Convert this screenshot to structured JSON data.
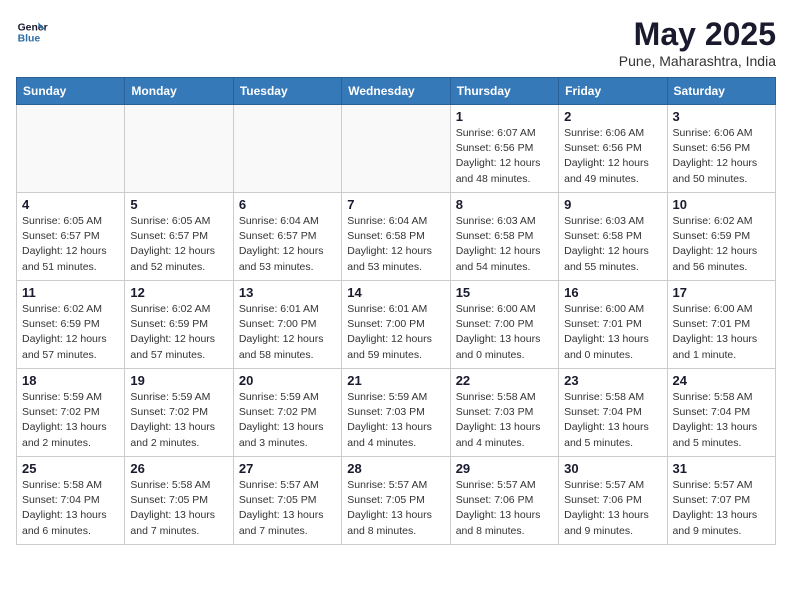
{
  "logo": {
    "line1": "General",
    "line2": "Blue"
  },
  "title": "May 2025",
  "location": "Pune, Maharashtra, India",
  "weekdays": [
    "Sunday",
    "Monday",
    "Tuesday",
    "Wednesday",
    "Thursday",
    "Friday",
    "Saturday"
  ],
  "weeks": [
    [
      {
        "day": "",
        "info": ""
      },
      {
        "day": "",
        "info": ""
      },
      {
        "day": "",
        "info": ""
      },
      {
        "day": "",
        "info": ""
      },
      {
        "day": "1",
        "info": "Sunrise: 6:07 AM\nSunset: 6:56 PM\nDaylight: 12 hours\nand 48 minutes."
      },
      {
        "day": "2",
        "info": "Sunrise: 6:06 AM\nSunset: 6:56 PM\nDaylight: 12 hours\nand 49 minutes."
      },
      {
        "day": "3",
        "info": "Sunrise: 6:06 AM\nSunset: 6:56 PM\nDaylight: 12 hours\nand 50 minutes."
      }
    ],
    [
      {
        "day": "4",
        "info": "Sunrise: 6:05 AM\nSunset: 6:57 PM\nDaylight: 12 hours\nand 51 minutes."
      },
      {
        "day": "5",
        "info": "Sunrise: 6:05 AM\nSunset: 6:57 PM\nDaylight: 12 hours\nand 52 minutes."
      },
      {
        "day": "6",
        "info": "Sunrise: 6:04 AM\nSunset: 6:57 PM\nDaylight: 12 hours\nand 53 minutes."
      },
      {
        "day": "7",
        "info": "Sunrise: 6:04 AM\nSunset: 6:58 PM\nDaylight: 12 hours\nand 53 minutes."
      },
      {
        "day": "8",
        "info": "Sunrise: 6:03 AM\nSunset: 6:58 PM\nDaylight: 12 hours\nand 54 minutes."
      },
      {
        "day": "9",
        "info": "Sunrise: 6:03 AM\nSunset: 6:58 PM\nDaylight: 12 hours\nand 55 minutes."
      },
      {
        "day": "10",
        "info": "Sunrise: 6:02 AM\nSunset: 6:59 PM\nDaylight: 12 hours\nand 56 minutes."
      }
    ],
    [
      {
        "day": "11",
        "info": "Sunrise: 6:02 AM\nSunset: 6:59 PM\nDaylight: 12 hours\nand 57 minutes."
      },
      {
        "day": "12",
        "info": "Sunrise: 6:02 AM\nSunset: 6:59 PM\nDaylight: 12 hours\nand 57 minutes."
      },
      {
        "day": "13",
        "info": "Sunrise: 6:01 AM\nSunset: 7:00 PM\nDaylight: 12 hours\nand 58 minutes."
      },
      {
        "day": "14",
        "info": "Sunrise: 6:01 AM\nSunset: 7:00 PM\nDaylight: 12 hours\nand 59 minutes."
      },
      {
        "day": "15",
        "info": "Sunrise: 6:00 AM\nSunset: 7:00 PM\nDaylight: 13 hours\nand 0 minutes."
      },
      {
        "day": "16",
        "info": "Sunrise: 6:00 AM\nSunset: 7:01 PM\nDaylight: 13 hours\nand 0 minutes."
      },
      {
        "day": "17",
        "info": "Sunrise: 6:00 AM\nSunset: 7:01 PM\nDaylight: 13 hours\nand 1 minute."
      }
    ],
    [
      {
        "day": "18",
        "info": "Sunrise: 5:59 AM\nSunset: 7:02 PM\nDaylight: 13 hours\nand 2 minutes."
      },
      {
        "day": "19",
        "info": "Sunrise: 5:59 AM\nSunset: 7:02 PM\nDaylight: 13 hours\nand 2 minutes."
      },
      {
        "day": "20",
        "info": "Sunrise: 5:59 AM\nSunset: 7:02 PM\nDaylight: 13 hours\nand 3 minutes."
      },
      {
        "day": "21",
        "info": "Sunrise: 5:59 AM\nSunset: 7:03 PM\nDaylight: 13 hours\nand 4 minutes."
      },
      {
        "day": "22",
        "info": "Sunrise: 5:58 AM\nSunset: 7:03 PM\nDaylight: 13 hours\nand 4 minutes."
      },
      {
        "day": "23",
        "info": "Sunrise: 5:58 AM\nSunset: 7:04 PM\nDaylight: 13 hours\nand 5 minutes."
      },
      {
        "day": "24",
        "info": "Sunrise: 5:58 AM\nSunset: 7:04 PM\nDaylight: 13 hours\nand 5 minutes."
      }
    ],
    [
      {
        "day": "25",
        "info": "Sunrise: 5:58 AM\nSunset: 7:04 PM\nDaylight: 13 hours\nand 6 minutes."
      },
      {
        "day": "26",
        "info": "Sunrise: 5:58 AM\nSunset: 7:05 PM\nDaylight: 13 hours\nand 7 minutes."
      },
      {
        "day": "27",
        "info": "Sunrise: 5:57 AM\nSunset: 7:05 PM\nDaylight: 13 hours\nand 7 minutes."
      },
      {
        "day": "28",
        "info": "Sunrise: 5:57 AM\nSunset: 7:05 PM\nDaylight: 13 hours\nand 8 minutes."
      },
      {
        "day": "29",
        "info": "Sunrise: 5:57 AM\nSunset: 7:06 PM\nDaylight: 13 hours\nand 8 minutes."
      },
      {
        "day": "30",
        "info": "Sunrise: 5:57 AM\nSunset: 7:06 PM\nDaylight: 13 hours\nand 9 minutes."
      },
      {
        "day": "31",
        "info": "Sunrise: 5:57 AM\nSunset: 7:07 PM\nDaylight: 13 hours\nand 9 minutes."
      }
    ]
  ]
}
